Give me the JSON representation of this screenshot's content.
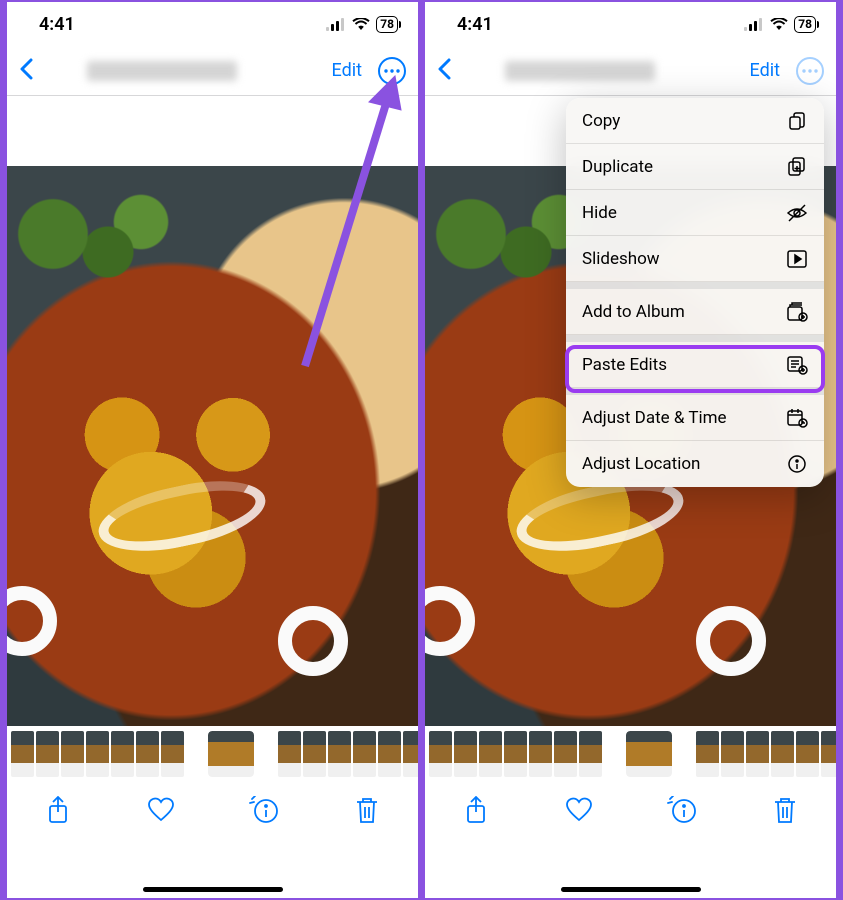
{
  "status": {
    "time": "4:41",
    "battery": "78"
  },
  "nav": {
    "edit_label": "Edit"
  },
  "toolbar": {
    "share": "share-icon",
    "heart": "heart-icon",
    "info": "info-icon",
    "trash": "trash-icon"
  },
  "menu": {
    "items": [
      {
        "label": "Copy",
        "icon": "copy-icon"
      },
      {
        "label": "Duplicate",
        "icon": "duplicate-icon"
      },
      {
        "label": "Hide",
        "icon": "hide-icon"
      },
      {
        "label": "Slideshow",
        "icon": "slideshow-icon"
      }
    ],
    "items2": [
      {
        "label": "Add to Album",
        "icon": "album-icon"
      }
    ],
    "items3": [
      {
        "label": "Paste Edits",
        "icon": "paste-edits-icon"
      }
    ],
    "items4": [
      {
        "label": "Adjust Date & Time",
        "icon": "calendar-icon"
      },
      {
        "label": "Adjust Location",
        "icon": "location-icon"
      }
    ]
  }
}
